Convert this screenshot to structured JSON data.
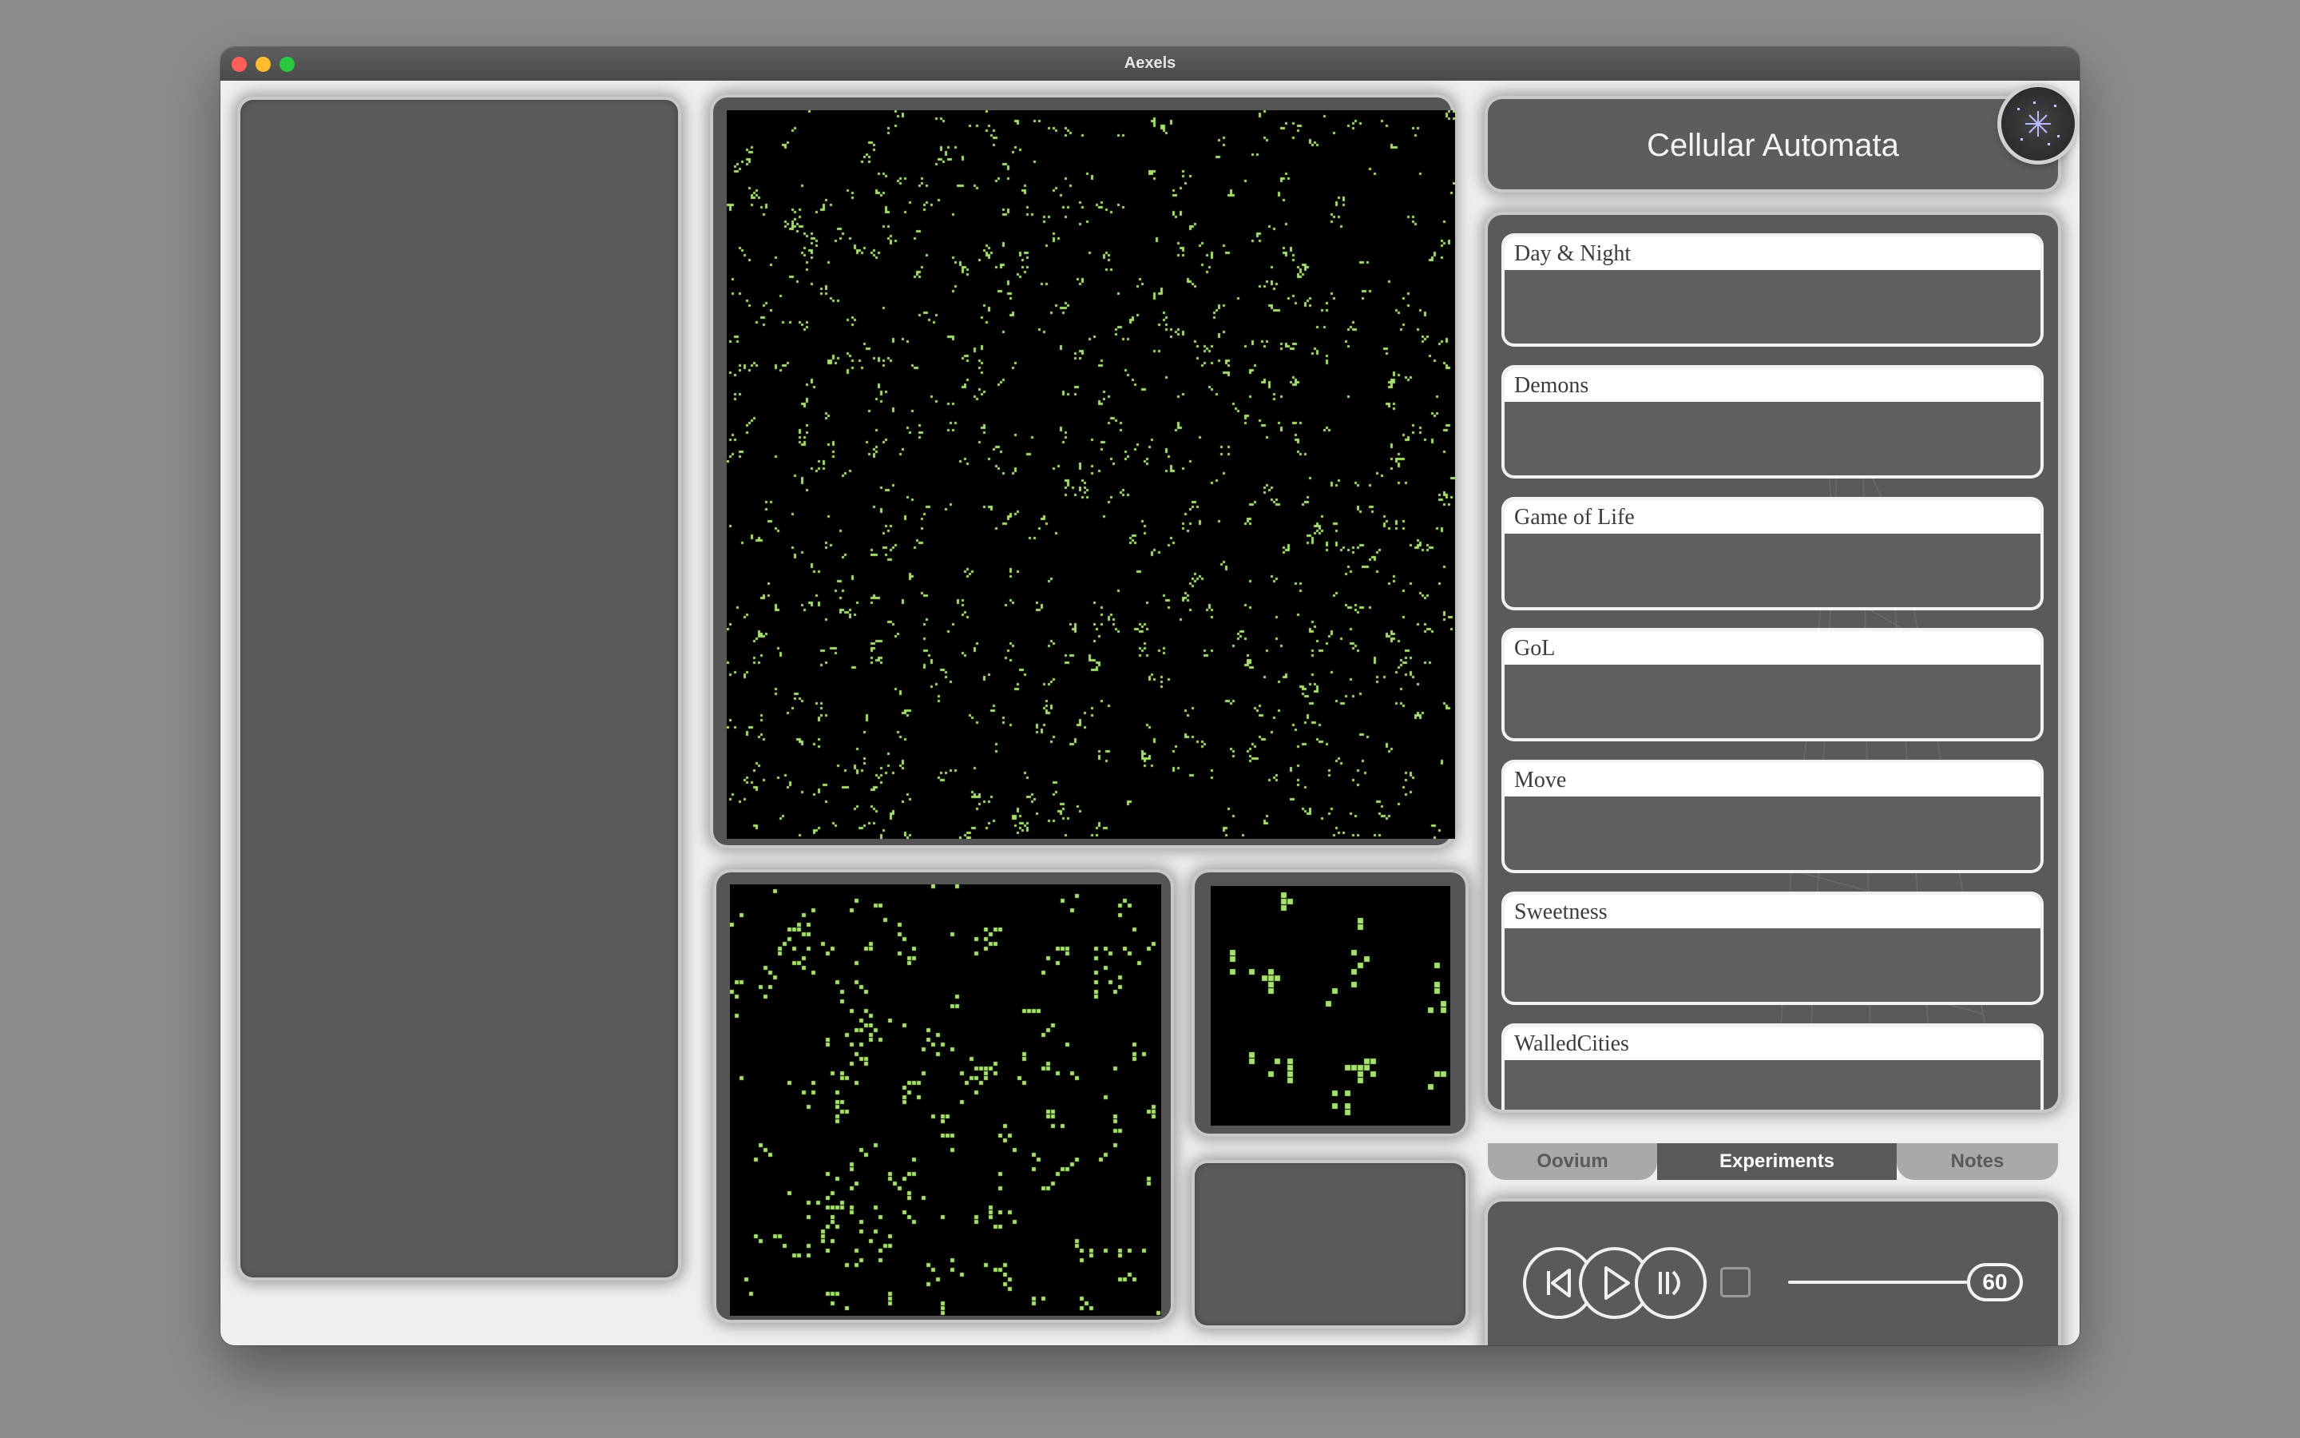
{
  "window": {
    "title": "Aexels"
  },
  "header": {
    "title": "Cellular Automata",
    "logo_icon": "aexels-logo-icon"
  },
  "experiments": [
    {
      "label": "Day & Night"
    },
    {
      "label": "Demons"
    },
    {
      "label": "Game of Life"
    },
    {
      "label": "GoL"
    },
    {
      "label": "Move"
    },
    {
      "label": "Sweetness"
    },
    {
      "label": "WalledCities"
    }
  ],
  "tabs": [
    {
      "label": "Oovium",
      "active": false
    },
    {
      "label": "Experiments",
      "active": true
    },
    {
      "label": "Notes",
      "active": false
    }
  ],
  "controls": {
    "rewind_icon": "skip-back-icon",
    "play_icon": "play-icon",
    "step_icon": "step-forward-icon",
    "checkbox_checked": false,
    "speed_value": "60"
  },
  "colors": {
    "cell_alive": "#a8e070",
    "cell_bg": "#000000",
    "panel": "#5a5a5a"
  }
}
